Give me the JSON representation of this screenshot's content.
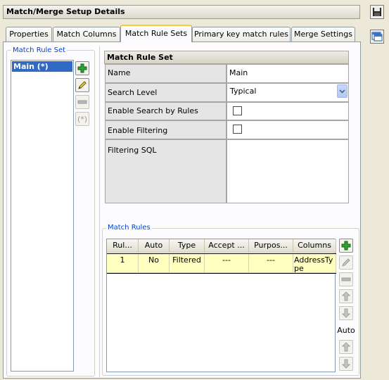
{
  "window": {
    "title": "Match/Merge Setup Details"
  },
  "tabs": [
    {
      "label": "Properties"
    },
    {
      "label": "Match Columns"
    },
    {
      "label": "Match Rule Sets"
    },
    {
      "label": "Primary key match rules"
    },
    {
      "label": "Merge Settings"
    }
  ],
  "active_tab": "Match Rule Sets",
  "rule_set_panel": {
    "group_label": "Match Rule Set",
    "items": [
      {
        "label": "Main (*)",
        "selected": true
      }
    ],
    "default_button_label": "(*)"
  },
  "properties": {
    "header": "Match Rule Set",
    "name_label": "Name",
    "name_value": "Main",
    "search_level_label": "Search Level",
    "search_level_value": "Typical",
    "enable_search_label": "Enable Search by Rules",
    "enable_search_checked": false,
    "enable_filtering_label": "Enable Filtering",
    "enable_filtering_checked": false,
    "filtering_sql_label": "Filtering SQL",
    "filtering_sql_value": ""
  },
  "match_rules": {
    "group_label": "Match Rules",
    "columns": [
      "Rul...",
      "Auto",
      "Type",
      "Accept ...",
      "Purpos...",
      "Columns"
    ],
    "rows": [
      {
        "rule": "1",
        "auto": "No",
        "type": "Filtered",
        "accept": "---",
        "purpose": "---",
        "columns": "AddressType"
      }
    ],
    "auto_label": "Auto"
  },
  "colors": {
    "accent": "#316ac5",
    "group_label": "#0046d5",
    "tab_highlight": "#ffc73c",
    "row_highlight": "#ffffc0",
    "add_green": "#2fa22f"
  }
}
